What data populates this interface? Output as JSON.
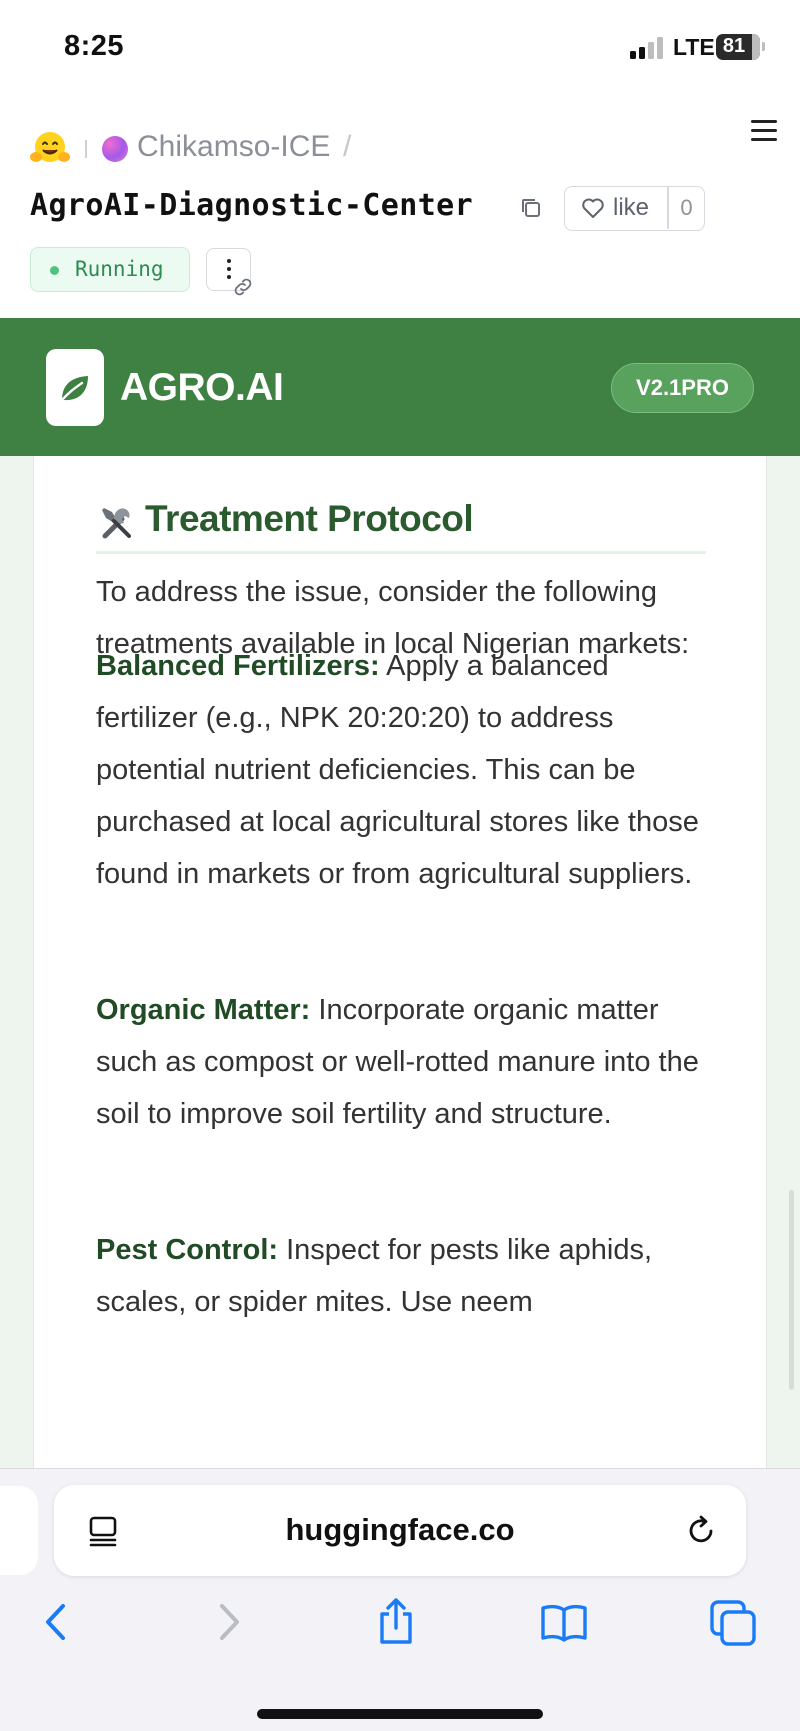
{
  "status_bar": {
    "time": "8:25",
    "network": "LTE",
    "battery": "81"
  },
  "space_header": {
    "owner": "Chikamso-ICE",
    "separator": "/",
    "title": "AgroAI-Diagnostic-Center",
    "like_label": "like",
    "like_count": "0",
    "status": "Running"
  },
  "app": {
    "brand": "AGRO.AI",
    "version": "V2.1PRO",
    "section_emoji": "🛠️",
    "section_title": "Treatment Protocol",
    "intro": "To address the issue, consider the following treatments available in local Nigerian markets:",
    "items": [
      {
        "label": "Balanced Fertilizers:",
        "text": " Apply a balanced fertilizer (e.g., NPK 20:20:20) to address potential nutrient deficiencies. This can be purchased at local agricultural stores like those found in markets or from agricultural suppliers."
      },
      {
        "label": "Organic Matter:",
        "text": " Incorporate organic matter such as compost or well-rotted manure into the soil to improve soil fertility and structure."
      },
      {
        "label": "Pest Control:",
        "text": " Inspect for pests like aphids, scales, or spider mites. Use neem"
      }
    ]
  },
  "browser": {
    "url": "huggingface.co"
  },
  "colors": {
    "header_green": "#3e8142",
    "heading_green": "#2a5a2e",
    "label_green": "#204b25",
    "running_green": "#2d8a52",
    "ios_blue": "#1a7cf5"
  },
  "icons": {
    "section": "tools-icon",
    "brand": "leaf-icon",
    "reader": "reader-mode-icon",
    "reload": "reload-icon",
    "back": "chevron-left-icon",
    "forward": "chevron-right-icon",
    "share": "share-icon",
    "bookmarks": "book-icon",
    "tabs": "tabs-icon"
  }
}
